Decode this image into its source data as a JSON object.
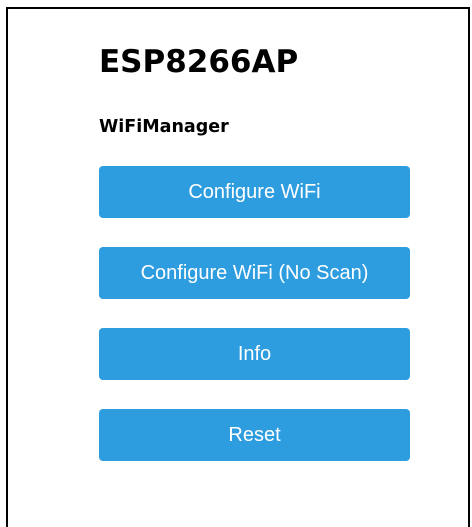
{
  "page": {
    "title": "ESP8266AP",
    "subtitle": "WiFiManager"
  },
  "menu": {
    "buttons": [
      {
        "label": "Configure WiFi"
      },
      {
        "label": "Configure WiFi (No Scan)"
      },
      {
        "label": "Info"
      },
      {
        "label": "Reset"
      }
    ]
  },
  "colors": {
    "button_background": "#2d9de0",
    "button_text": "#ffffff",
    "text": "#000000",
    "background": "#ffffff"
  }
}
